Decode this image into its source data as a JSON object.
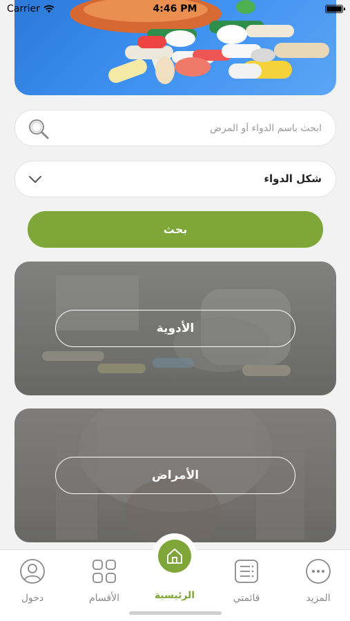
{
  "status_bar": {
    "carrier": "Carrier",
    "time": "4:46 PM"
  },
  "search": {
    "placeholder": "ابحث باسم الدواء أو المرض"
  },
  "dosage_form": {
    "label": "شكل الدواء"
  },
  "search_button": {
    "label": "بحث"
  },
  "cards": {
    "medicines": "الأدوية",
    "diseases": "الأمراض"
  },
  "tabs": {
    "more": "المزيد",
    "my_list": "قائمتي",
    "home": "الرئيسية",
    "categories": "الأقسام",
    "login": "دخول"
  },
  "colors": {
    "accent": "#7fa638",
    "background": "#f2f2f2"
  }
}
